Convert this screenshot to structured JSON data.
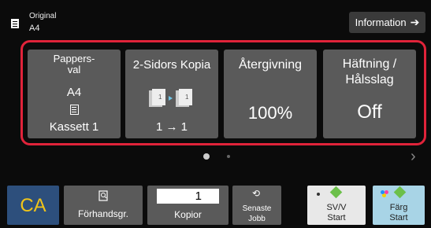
{
  "header": {
    "original_label": "Original",
    "original_size": "A4",
    "info_label": "Information"
  },
  "functions": {
    "paper": {
      "label_line1": "Pappers-",
      "label_line2": "val",
      "size": "A4",
      "tray": "Kassett 1"
    },
    "duplex": {
      "label": "2-Sidors Kopia",
      "mode": "1 → 1"
    },
    "reproduction": {
      "label": "Återgivning",
      "value": "100%"
    },
    "staple": {
      "label_line1": "Häftning /",
      "label_line2": "Hålsslag",
      "value": "Off"
    }
  },
  "bottom": {
    "ca_label": "CA",
    "preview_label": "Förhandsgr.",
    "copies_value": "1",
    "copies_label": "Kopior",
    "recent_line1": "Senaste",
    "recent_line2": "Jobb",
    "bw_line1": "SV/V",
    "bw_line2": "Start",
    "color_line1": "Färg",
    "color_line2": "Start"
  },
  "colors": {
    "highlight_frame": "#e0233a",
    "ca_text": "#f0c419",
    "ca_bg": "#2d4f7c",
    "start_icon": "#6cc04a",
    "color_start_bg": "#a8d4e6"
  },
  "icons": {
    "original": "original-document-icon",
    "info": "arrow-right-icon",
    "tray": "paper-tray-icon",
    "duplex": "duplex-copy-icon",
    "preview": "preview-icon",
    "recent": "recent-jobs-icon",
    "start": "start-diamond-icon",
    "next": "chevron-right-icon"
  }
}
